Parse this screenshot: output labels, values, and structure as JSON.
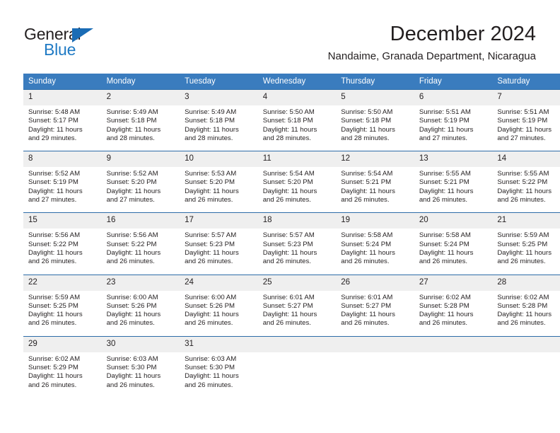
{
  "brand": {
    "name_part1": "General",
    "name_part2": "Blue",
    "triangle_color": "#1a6cb5",
    "blue_text_color": "#1f7ac4"
  },
  "header": {
    "title": "December 2024",
    "subtitle": "Nandaime, Granada Department, Nicaragua"
  },
  "theme": {
    "header_row_bg": "#3a7cbe",
    "row_divider": "#2d6ca8",
    "daynum_bg": "#efefef",
    "text": "#231f20"
  },
  "weekdays": [
    "Sunday",
    "Monday",
    "Tuesday",
    "Wednesday",
    "Thursday",
    "Friday",
    "Saturday"
  ],
  "weeks": [
    [
      {
        "day": "1",
        "sunrise": "Sunrise: 5:48 AM",
        "sunset": "Sunset: 5:17 PM",
        "daylight1": "Daylight: 11 hours",
        "daylight2": "and 29 minutes."
      },
      {
        "day": "2",
        "sunrise": "Sunrise: 5:49 AM",
        "sunset": "Sunset: 5:18 PM",
        "daylight1": "Daylight: 11 hours",
        "daylight2": "and 28 minutes."
      },
      {
        "day": "3",
        "sunrise": "Sunrise: 5:49 AM",
        "sunset": "Sunset: 5:18 PM",
        "daylight1": "Daylight: 11 hours",
        "daylight2": "and 28 minutes."
      },
      {
        "day": "4",
        "sunrise": "Sunrise: 5:50 AM",
        "sunset": "Sunset: 5:18 PM",
        "daylight1": "Daylight: 11 hours",
        "daylight2": "and 28 minutes."
      },
      {
        "day": "5",
        "sunrise": "Sunrise: 5:50 AM",
        "sunset": "Sunset: 5:18 PM",
        "daylight1": "Daylight: 11 hours",
        "daylight2": "and 28 minutes."
      },
      {
        "day": "6",
        "sunrise": "Sunrise: 5:51 AM",
        "sunset": "Sunset: 5:19 PM",
        "daylight1": "Daylight: 11 hours",
        "daylight2": "and 27 minutes."
      },
      {
        "day": "7",
        "sunrise": "Sunrise: 5:51 AM",
        "sunset": "Sunset: 5:19 PM",
        "daylight1": "Daylight: 11 hours",
        "daylight2": "and 27 minutes."
      }
    ],
    [
      {
        "day": "8",
        "sunrise": "Sunrise: 5:52 AM",
        "sunset": "Sunset: 5:19 PM",
        "daylight1": "Daylight: 11 hours",
        "daylight2": "and 27 minutes."
      },
      {
        "day": "9",
        "sunrise": "Sunrise: 5:52 AM",
        "sunset": "Sunset: 5:20 PM",
        "daylight1": "Daylight: 11 hours",
        "daylight2": "and 27 minutes."
      },
      {
        "day": "10",
        "sunrise": "Sunrise: 5:53 AM",
        "sunset": "Sunset: 5:20 PM",
        "daylight1": "Daylight: 11 hours",
        "daylight2": "and 26 minutes."
      },
      {
        "day": "11",
        "sunrise": "Sunrise: 5:54 AM",
        "sunset": "Sunset: 5:20 PM",
        "daylight1": "Daylight: 11 hours",
        "daylight2": "and 26 minutes."
      },
      {
        "day": "12",
        "sunrise": "Sunrise: 5:54 AM",
        "sunset": "Sunset: 5:21 PM",
        "daylight1": "Daylight: 11 hours",
        "daylight2": "and 26 minutes."
      },
      {
        "day": "13",
        "sunrise": "Sunrise: 5:55 AM",
        "sunset": "Sunset: 5:21 PM",
        "daylight1": "Daylight: 11 hours",
        "daylight2": "and 26 minutes."
      },
      {
        "day": "14",
        "sunrise": "Sunrise: 5:55 AM",
        "sunset": "Sunset: 5:22 PM",
        "daylight1": "Daylight: 11 hours",
        "daylight2": "and 26 minutes."
      }
    ],
    [
      {
        "day": "15",
        "sunrise": "Sunrise: 5:56 AM",
        "sunset": "Sunset: 5:22 PM",
        "daylight1": "Daylight: 11 hours",
        "daylight2": "and 26 minutes."
      },
      {
        "day": "16",
        "sunrise": "Sunrise: 5:56 AM",
        "sunset": "Sunset: 5:22 PM",
        "daylight1": "Daylight: 11 hours",
        "daylight2": "and 26 minutes."
      },
      {
        "day": "17",
        "sunrise": "Sunrise: 5:57 AM",
        "sunset": "Sunset: 5:23 PM",
        "daylight1": "Daylight: 11 hours",
        "daylight2": "and 26 minutes."
      },
      {
        "day": "18",
        "sunrise": "Sunrise: 5:57 AM",
        "sunset": "Sunset: 5:23 PM",
        "daylight1": "Daylight: 11 hours",
        "daylight2": "and 26 minutes."
      },
      {
        "day": "19",
        "sunrise": "Sunrise: 5:58 AM",
        "sunset": "Sunset: 5:24 PM",
        "daylight1": "Daylight: 11 hours",
        "daylight2": "and 26 minutes."
      },
      {
        "day": "20",
        "sunrise": "Sunrise: 5:58 AM",
        "sunset": "Sunset: 5:24 PM",
        "daylight1": "Daylight: 11 hours",
        "daylight2": "and 26 minutes."
      },
      {
        "day": "21",
        "sunrise": "Sunrise: 5:59 AM",
        "sunset": "Sunset: 5:25 PM",
        "daylight1": "Daylight: 11 hours",
        "daylight2": "and 26 minutes."
      }
    ],
    [
      {
        "day": "22",
        "sunrise": "Sunrise: 5:59 AM",
        "sunset": "Sunset: 5:25 PM",
        "daylight1": "Daylight: 11 hours",
        "daylight2": "and 26 minutes."
      },
      {
        "day": "23",
        "sunrise": "Sunrise: 6:00 AM",
        "sunset": "Sunset: 5:26 PM",
        "daylight1": "Daylight: 11 hours",
        "daylight2": "and 26 minutes."
      },
      {
        "day": "24",
        "sunrise": "Sunrise: 6:00 AM",
        "sunset": "Sunset: 5:26 PM",
        "daylight1": "Daylight: 11 hours",
        "daylight2": "and 26 minutes."
      },
      {
        "day": "25",
        "sunrise": "Sunrise: 6:01 AM",
        "sunset": "Sunset: 5:27 PM",
        "daylight1": "Daylight: 11 hours",
        "daylight2": "and 26 minutes."
      },
      {
        "day": "26",
        "sunrise": "Sunrise: 6:01 AM",
        "sunset": "Sunset: 5:27 PM",
        "daylight1": "Daylight: 11 hours",
        "daylight2": "and 26 minutes."
      },
      {
        "day": "27",
        "sunrise": "Sunrise: 6:02 AM",
        "sunset": "Sunset: 5:28 PM",
        "daylight1": "Daylight: 11 hours",
        "daylight2": "and 26 minutes."
      },
      {
        "day": "28",
        "sunrise": "Sunrise: 6:02 AM",
        "sunset": "Sunset: 5:28 PM",
        "daylight1": "Daylight: 11 hours",
        "daylight2": "and 26 minutes."
      }
    ],
    [
      {
        "day": "29",
        "sunrise": "Sunrise: 6:02 AM",
        "sunset": "Sunset: 5:29 PM",
        "daylight1": "Daylight: 11 hours",
        "daylight2": "and 26 minutes."
      },
      {
        "day": "30",
        "sunrise": "Sunrise: 6:03 AM",
        "sunset": "Sunset: 5:30 PM",
        "daylight1": "Daylight: 11 hours",
        "daylight2": "and 26 minutes."
      },
      {
        "day": "31",
        "sunrise": "Sunrise: 6:03 AM",
        "sunset": "Sunset: 5:30 PM",
        "daylight1": "Daylight: 11 hours",
        "daylight2": "and 26 minutes."
      },
      {
        "day": "",
        "sunrise": "",
        "sunset": "",
        "daylight1": "",
        "daylight2": ""
      },
      {
        "day": "",
        "sunrise": "",
        "sunset": "",
        "daylight1": "",
        "daylight2": ""
      },
      {
        "day": "",
        "sunrise": "",
        "sunset": "",
        "daylight1": "",
        "daylight2": ""
      },
      {
        "day": "",
        "sunrise": "",
        "sunset": "",
        "daylight1": "",
        "daylight2": ""
      }
    ]
  ]
}
